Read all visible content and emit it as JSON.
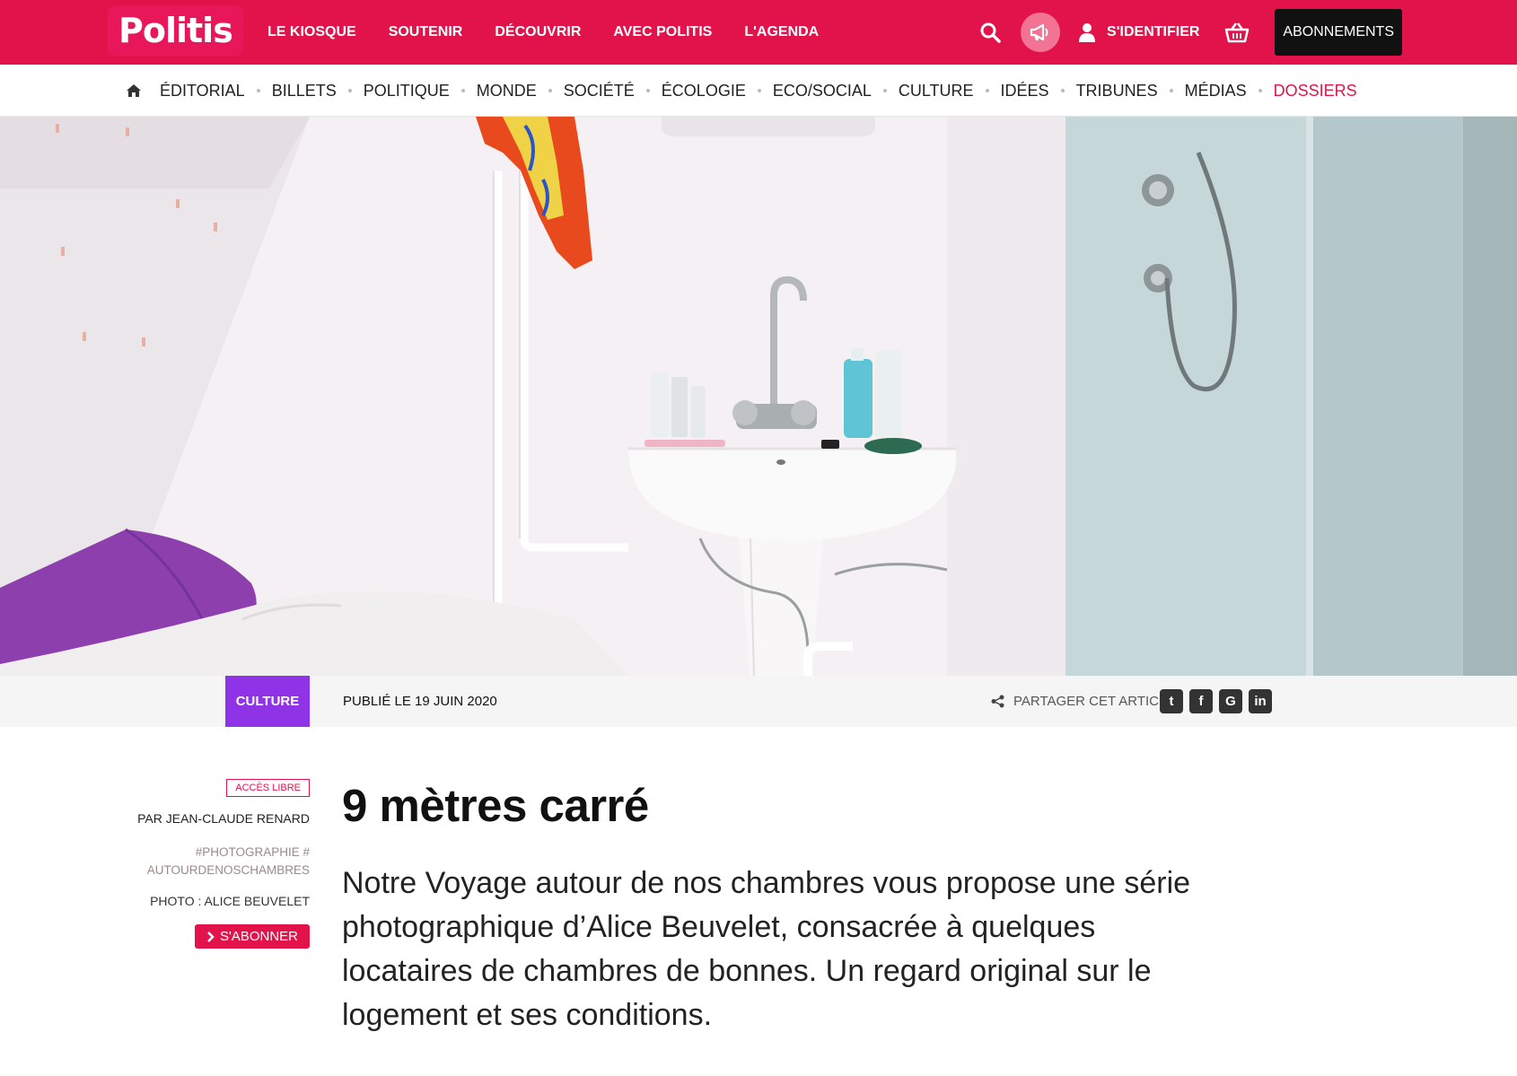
{
  "brand": {
    "name": "Politis",
    "accent": "#e2134a",
    "category_color": "#8f33e6"
  },
  "topnav": {
    "items": [
      "LE KIOSQUE",
      "SOUTENIR",
      "DÉCOUVRIR",
      "AVEC POLITIS",
      "L'AGENDA"
    ],
    "login_label": "S'IDENTIFIER",
    "subscribe_label": "ABONNEMENTS",
    "icons": [
      "search-icon",
      "megaphone-icon",
      "user-icon",
      "basket-icon"
    ]
  },
  "subnav": {
    "home_icon": "home-icon",
    "items": [
      "ÉDITORIAL",
      "BILLETS",
      "POLITIQUE",
      "MONDE",
      "SOCIÉTÉ",
      "ÉCOLOGIE",
      "ECO/SOCIAL",
      "CULTURE",
      "IDÉES",
      "TRIBUNES",
      "MÉDIAS",
      "DOSSIERS"
    ],
    "highlighted": "DOSSIERS"
  },
  "meta": {
    "category": "CULTURE",
    "published": "PUBLIÉ LE 19 JUIN 2020",
    "share_label": "PARTAGER CET ARTICLE",
    "social": [
      {
        "name": "twitter-icon",
        "glyph": "t"
      },
      {
        "name": "facebook-icon",
        "glyph": "f"
      },
      {
        "name": "google-icon",
        "glyph": "G"
      },
      {
        "name": "linkedin-icon",
        "glyph": "in"
      }
    ]
  },
  "article": {
    "access": "ACCÈS LIBRE",
    "author": "PAR JEAN-CLAUDE RENARD",
    "tag1": "#PHOTOGRAPHIE #",
    "tag2": "AUTOURDENOSCHAMBRES",
    "photo_credit": "PHOTO : ALICE BEUVELET",
    "subscribe_label": "S'ABONNER",
    "title": "9 mètres carré",
    "lead": "Notre Voyage autour de nos chambres vous propose une série photographique d’Alice Beuvelet, consacrée à quelques locataires de chambres de bonnes. Un regard original sur le logement et ses conditions."
  }
}
